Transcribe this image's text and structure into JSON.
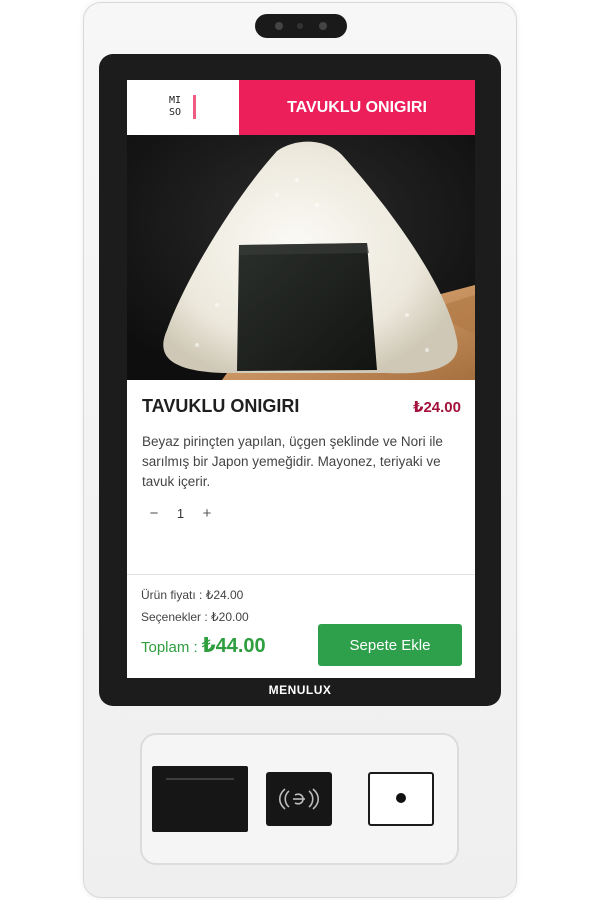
{
  "device": {
    "brand": "MENULUX"
  },
  "header": {
    "logo_text_line1": "MI",
    "logo_text_line2": "SO",
    "title": "TAVUKLU ONIGIRI"
  },
  "product": {
    "name": "TAVUKLU ONIGIRI",
    "price": "₺24.00",
    "description": "Beyaz pirinçten yapılan, üçgen şeklinde ve Nori ile sarılmış bir Japon yemeğidir. Mayonez, teriyaki ve tavuk içerir.",
    "quantity": "1",
    "decrement_symbol": "−",
    "increment_symbol": "+"
  },
  "summary": {
    "item_price_label": "Ürün fiyatı : ₺24.00",
    "options_label": "Seçenekler : ₺20.00",
    "total_label": "Toplam :",
    "total_value": "₺44.00",
    "add_to_cart": "Sepete Ekle"
  },
  "colors": {
    "accent_red": "#ec1f5a",
    "price_red": "#a3123c",
    "green": "#2ea04b"
  },
  "icons": {
    "nfc": "contactless-icon",
    "scanner": "qr-scanner-icon",
    "printer": "receipt-printer-icon"
  }
}
